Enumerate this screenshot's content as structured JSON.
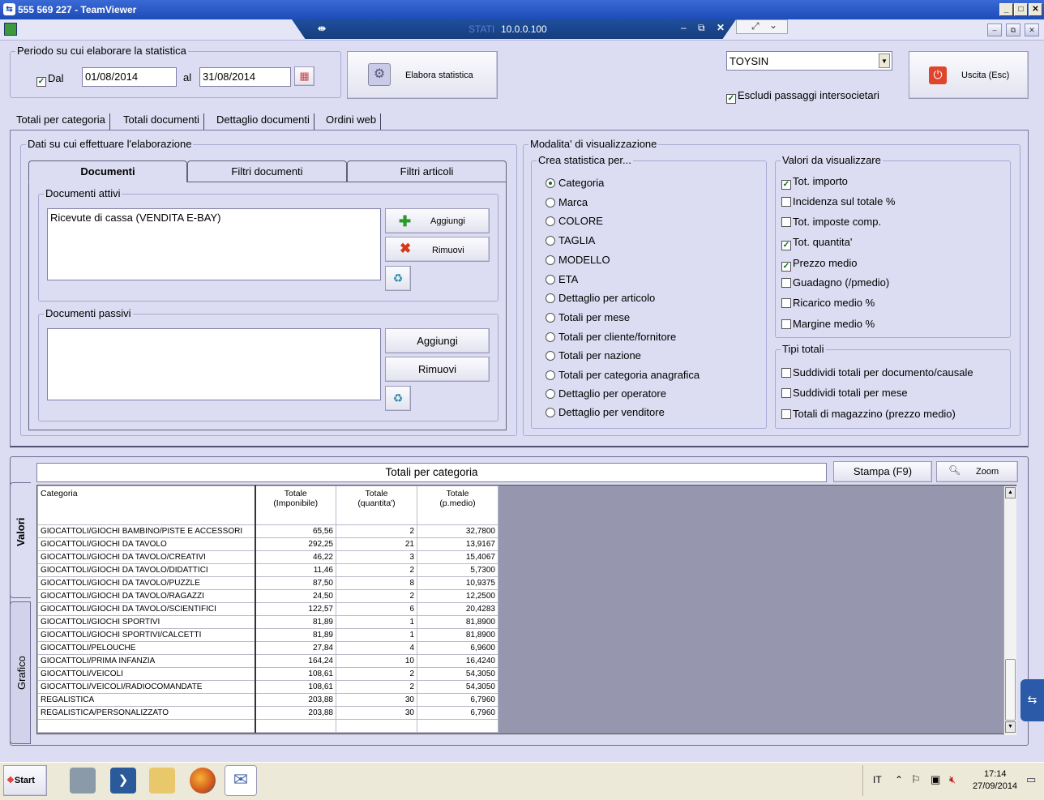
{
  "window": {
    "title": "555 569 227 - TeamViewer",
    "tab_label": "STATI",
    "ip": "10.0.0.100"
  },
  "period": {
    "legend": "Periodo su cui elaborare la statistica",
    "dal_label": "Dal",
    "from": "01/08/2014",
    "al_label": "al",
    "to": "31/08/2014"
  },
  "toolbar": {
    "elabora": "Elabora statistica",
    "uscita": "Uscita (Esc)"
  },
  "company": {
    "selected": "TOYSIN",
    "exclude_label": "Escludi passaggi intersocietari"
  },
  "main_tabs": [
    "Totali per categoria",
    "Totali documenti",
    "Dettaglio documenti",
    "Ordini web"
  ],
  "data_panel": {
    "legend": "Dati su cui effettuare l'elaborazione",
    "tabs": [
      "Documenti",
      "Filtri documenti",
      "Filtri articoli"
    ],
    "attivi": {
      "legend": "Documenti attivi",
      "items": [
        "Ricevute di cassa (VENDITA E-BAY)"
      ],
      "add": "Aggiungi",
      "remove": "Rimuovi"
    },
    "passivi": {
      "legend": "Documenti passivi",
      "add": "Aggiungi",
      "remove": "Rimuovi"
    }
  },
  "view_mode": {
    "legend": "Modalita' di visualizzazione",
    "crea": {
      "legend": "Crea statistica per...",
      "selected": "Categoria",
      "options": [
        "Categoria",
        "Marca",
        "COLORE",
        "TAGLIA",
        "MODELLO",
        "ETA",
        "Dettaglio per articolo",
        "Totali per mese",
        "Totali per cliente/fornitore",
        "Totali per nazione",
        "Totali per categoria anagrafica",
        "Dettaglio per operatore",
        "Dettaglio per venditore"
      ]
    },
    "valori": {
      "legend": "Valori da visualizzare",
      "options": [
        {
          "label": "Tot. importo",
          "checked": true
        },
        {
          "label": "Incidenza sul totale %",
          "checked": false
        },
        {
          "label": "Tot. imposte comp.",
          "checked": false
        },
        {
          "label": "Tot. quantita'",
          "checked": true
        },
        {
          "label": "Prezzo medio",
          "checked": true
        },
        {
          "label": "Guadagno (/pmedio)",
          "checked": false
        },
        {
          "label": "Ricarico medio %",
          "checked": false
        },
        {
          "label": "Margine medio %",
          "checked": false
        }
      ]
    },
    "tipi": {
      "legend": "Tipi totali",
      "options": [
        {
          "label": "Suddividi totali per documento/causale",
          "checked": false
        },
        {
          "label": "Suddividi totali per mese",
          "checked": false
        },
        {
          "label": "Totali di magazzino (prezzo medio)",
          "checked": false
        }
      ]
    }
  },
  "results": {
    "title": "Totali per categoria",
    "stampa": "Stampa (F9)",
    "zoom": "Zoom",
    "side_tabs": [
      "Valori",
      "Grafico"
    ],
    "columns": [
      "Categoria",
      "Totale\n(Imponibile)",
      "Totale\n(quantita')",
      "Totale\n(p.medio)"
    ],
    "rows": [
      [
        "GIOCATTOLI/GIOCHI BAMBINO/PISTE E ACCESSORI",
        "65,56",
        "2",
        "32,7800"
      ],
      [
        "GIOCATTOLI/GIOCHI DA TAVOLO",
        "292,25",
        "21",
        "13,9167"
      ],
      [
        "GIOCATTOLI/GIOCHI DA TAVOLO/CREATIVI",
        "46,22",
        "3",
        "15,4067"
      ],
      [
        "GIOCATTOLI/GIOCHI DA TAVOLO/DIDATTICI",
        "11,46",
        "2",
        "5,7300"
      ],
      [
        "GIOCATTOLI/GIOCHI DA TAVOLO/PUZZLE",
        "87,50",
        "8",
        "10,9375"
      ],
      [
        "GIOCATTOLI/GIOCHI DA TAVOLO/RAGAZZI",
        "24,50",
        "2",
        "12,2500"
      ],
      [
        "GIOCATTOLI/GIOCHI DA TAVOLO/SCIENTIFICI",
        "122,57",
        "6",
        "20,4283"
      ],
      [
        "GIOCATTOLI/GIOCHI SPORTIVI",
        "81,89",
        "1",
        "81,8900"
      ],
      [
        "GIOCATTOLI/GIOCHI SPORTIVI/CALCETTI",
        "81,89",
        "1",
        "81,8900"
      ],
      [
        "GIOCATTOLI/PELOUCHE",
        "27,84",
        "4",
        "6,9600"
      ],
      [
        "GIOCATTOLI/PRIMA INFANZIA",
        "164,24",
        "10",
        "16,4240"
      ],
      [
        "GIOCATTOLI/VEICOLI",
        "108,61",
        "2",
        "54,3050"
      ],
      [
        "GIOCATTOLI/VEICOLI/RADIOCOMANDATE",
        "108,61",
        "2",
        "54,3050"
      ],
      [
        "REGALISTICA",
        "203,88",
        "30",
        "6,7960"
      ],
      [
        "REGALISTICA/PERSONALIZZATO",
        "203,88",
        "30",
        "6,7960"
      ]
    ]
  },
  "taskbar": {
    "start": "Start",
    "lang": "IT",
    "time": "17:14",
    "date": "27/09/2014"
  },
  "colors": {
    "title_blue": "#1d4bb8",
    "app_bg": "#dcdcf2",
    "grid_empty": "#9696ae"
  }
}
